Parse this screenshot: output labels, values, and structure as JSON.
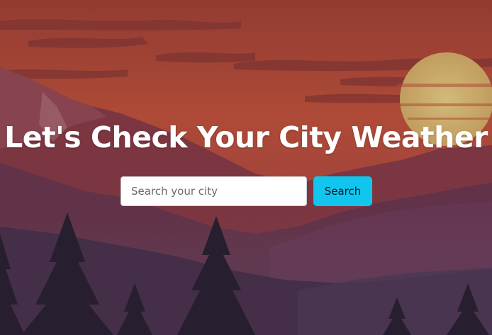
{
  "hero": {
    "title": "Let's Check Your City Weather"
  },
  "search": {
    "placeholder": "Search your city",
    "value": "",
    "button_label": "Search"
  },
  "colors": {
    "sky_top": "#b5473a",
    "sky_mid": "#c9573e",
    "sun": "#e6c37a",
    "button": "#12c5ef",
    "title": "#ffffff"
  }
}
